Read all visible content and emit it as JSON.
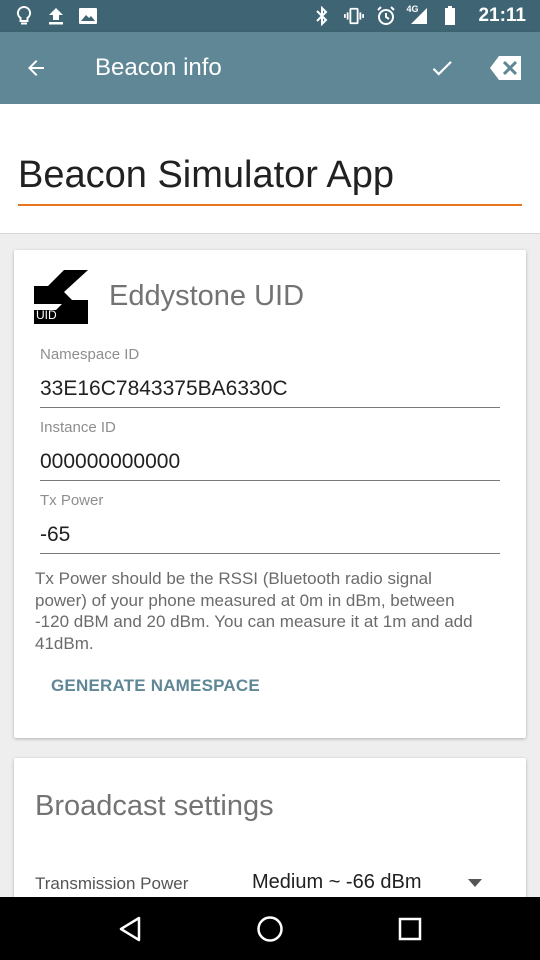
{
  "status_bar": {
    "time": "21:11",
    "network": "4G",
    "left_icons": [
      "lightbulb-icon",
      "upload-icon",
      "image-icon"
    ],
    "right_icons": [
      "bluetooth-icon",
      "vibrate-icon",
      "alarm-icon",
      "signal-icon",
      "battery-icon"
    ]
  },
  "app_bar": {
    "title": "Beacon info",
    "back_icon": "arrow-left-icon",
    "confirm_icon": "check-icon",
    "delete_icon": "backspace-icon"
  },
  "beacon_name": {
    "value": "Beacon Simulator App",
    "accent_color": "#e8761f"
  },
  "uid_card": {
    "logo_text": "UID",
    "title": "Eddystone UID",
    "fields": [
      {
        "label": "Namespace ID",
        "value": "33E16C7843375BA6330C"
      },
      {
        "label": "Instance ID",
        "value": "000000000000"
      },
      {
        "label": "Tx Power",
        "value": "-65"
      }
    ],
    "help_text": "Tx Power should be the RSSI (Bluetooth radio signal power) of your phone measured at 0m in dBm, between -120 dBM and 20 dBm. You can measure it at 1m and add 41dBm.",
    "generate_button": "GENERATE NAMESPACE"
  },
  "broadcast_card": {
    "title": "Broadcast settings",
    "transmission_label": "Transmission Power",
    "transmission_value": "Medium ~ -66 dBm"
  },
  "nav_bar": {
    "icons": [
      "back-triangle-icon",
      "home-circle-icon",
      "recents-square-icon"
    ]
  },
  "colors": {
    "status_bar": "#3f6574",
    "app_bar": "#5f8796",
    "accent": "#e8761f"
  }
}
